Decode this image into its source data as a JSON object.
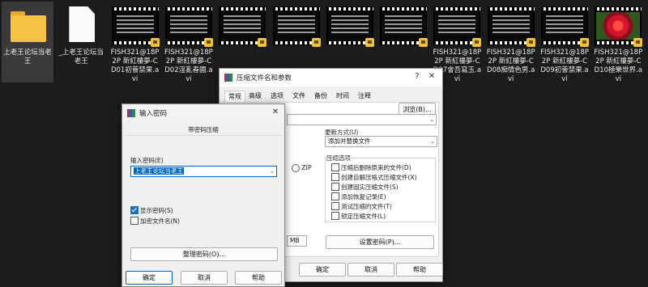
{
  "desktop": {
    "files": [
      {
        "type": "folder",
        "name": "上老王论坛当老王",
        "selected": true
      },
      {
        "type": "document",
        "name": "_上老王论坛当老王",
        "selected": false
      },
      {
        "type": "video",
        "name": "FISH321@18P2P 新紅樓夢-CD01初薈禁果.avi"
      },
      {
        "type": "video",
        "name": "FISH321@18P2P 新紅樓夢-CD02淫亂春圃.avi"
      },
      {
        "type": "video",
        "name": ""
      },
      {
        "type": "video",
        "name": ""
      },
      {
        "type": "video",
        "name": ""
      },
      {
        "type": "video",
        "name": ""
      },
      {
        "type": "video",
        "name": "FISH321@18P2P 新紅樓夢-CD07會吾寫玉.avi"
      },
      {
        "type": "video",
        "name": "FISH321@18P2P 新紅樓夢-CD08痴情色男.avi"
      },
      {
        "type": "video",
        "name": "FISH321@18P2P 新紅樓夢-CD09初薈禁果.avi"
      },
      {
        "type": "rose",
        "name": "FISH321@18P2P 新紅樓夢-CD10極樂世界.avi"
      }
    ]
  },
  "archive_dialog": {
    "title": "压缩文件名和参数",
    "help_button": "?",
    "close_button": "✕",
    "tabs": [
      "常规",
      "高级",
      "选项",
      "文件",
      "备份",
      "时间",
      "注释"
    ],
    "browse_button": "浏览(B)...",
    "update_mode_label": "更新方式(U)",
    "update_mode_value": "添加并替换文件",
    "format_zip": "ZIP",
    "options_group": "压缩选项",
    "options": [
      "压缩后删除原来的文件(D)",
      "创建自解压格式压缩文件(X)",
      "创建固实压缩文件(S)",
      "添加恢复记录(E)",
      "测试压缩的文件(T)",
      "锁定压缩文件(L)"
    ],
    "volume_unit": "MB",
    "set_password_button": "设置密码(P)...",
    "ok_button": "确定",
    "cancel_button": "取消",
    "help_bottom_button": "帮助"
  },
  "password_dialog": {
    "title": "输入密码",
    "close_button": "✕",
    "subtitle": "带密码压缩",
    "input_label": "输入密码(E)",
    "password_value": "上老王论坛当老王",
    "show_password_label": "显示密码(S)",
    "show_password_checked": true,
    "encrypt_names_label": "加密文件名(N)",
    "encrypt_names_checked": false,
    "organize_button": "整理密码(O)...",
    "ok_button": "确定",
    "cancel_button": "取消",
    "help_button": "帮助"
  },
  "colors": {
    "desktop_bg": "#1c1c1c",
    "selection": "#0067c0",
    "folder": "#f5c242"
  }
}
